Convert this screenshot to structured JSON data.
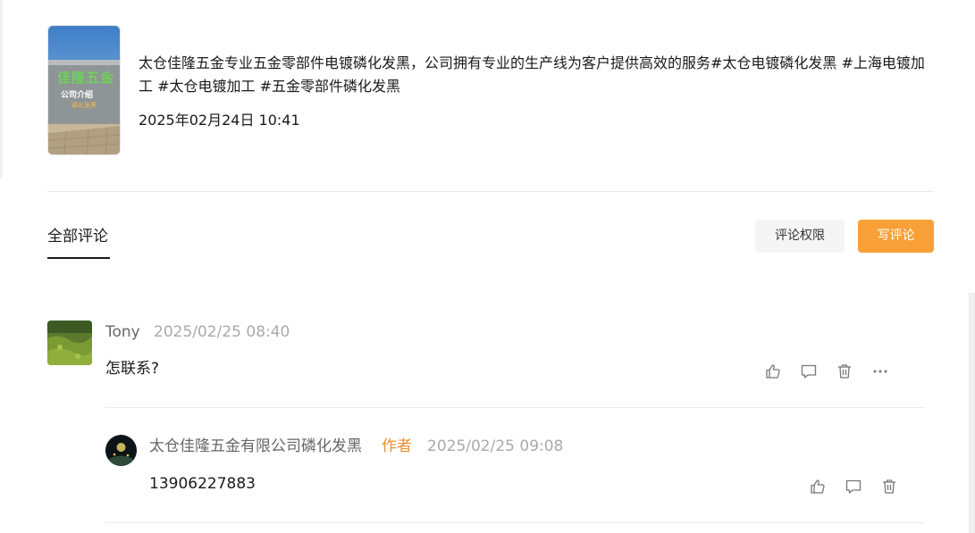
{
  "post": {
    "text": "太仓佳隆五金专业五金零部件电镀磷化发黑，公司拥有专业的生产线为客户提供高效的服务#太仓电镀磷化发黑 #上海电镀加工 #太仓电镀加工 #五金零部件磷化发黑",
    "date": "2025年02月24日 10:41",
    "thumb_text_big": "佳隆五金",
    "thumb_text_small": "公司介绍",
    "thumb_text_tag": "磷化发黑"
  },
  "comments_section": {
    "tab_label": "全部评论",
    "permission_button": "评论权限",
    "write_button": "写评论"
  },
  "comments": [
    {
      "user": "Tony",
      "time": "2025/02/25 08:40",
      "text": "怎联系?"
    }
  ],
  "replies": [
    {
      "user": "太仓佳隆五金有限公司磷化发黑",
      "badge": "作者",
      "time": "2025/02/25 09:08",
      "text": "13906227883"
    }
  ],
  "colors": {
    "accent": "#f9a038",
    "author_badge": "#e8902c"
  }
}
